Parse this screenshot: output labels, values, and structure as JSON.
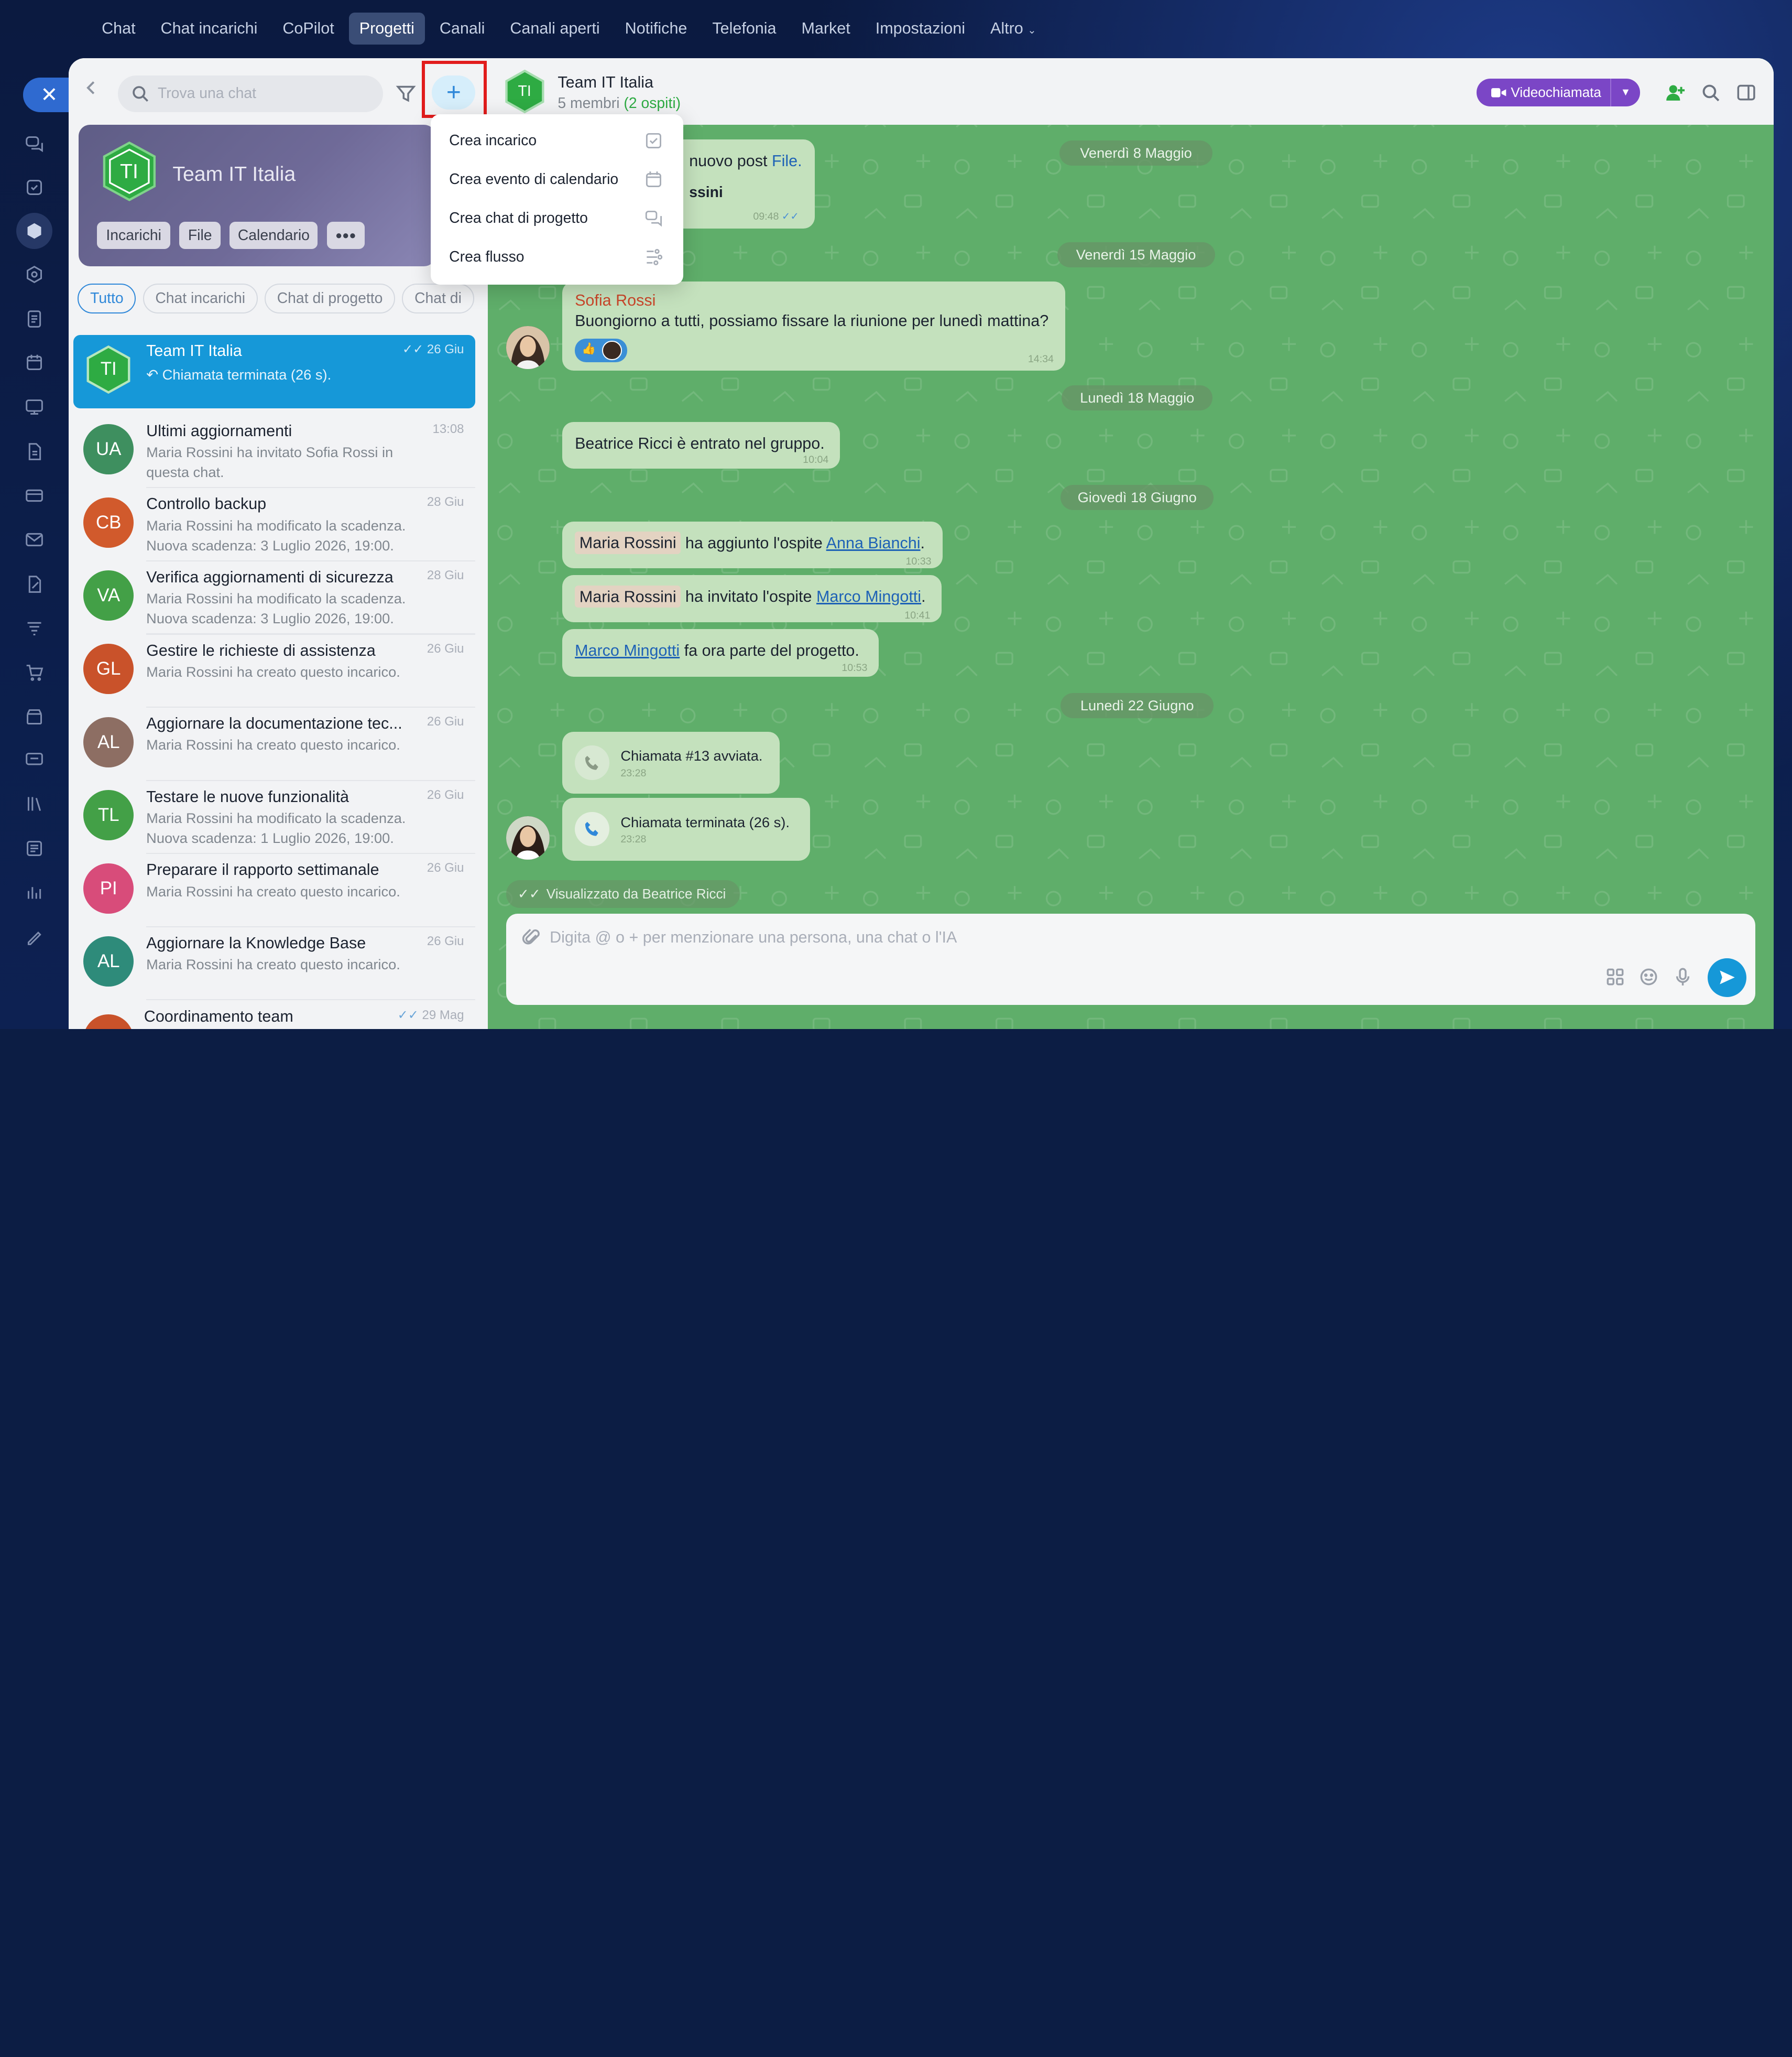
{
  "topnav": [
    "Chat",
    "Chat incarichi",
    "CoPilot",
    "Progetti",
    "Canali",
    "Canali aperti",
    "Notifiche",
    "Telefonia",
    "Market",
    "Impostazioni",
    "Altro"
  ],
  "topnav_active": "Progetti",
  "search": {
    "placeholder": "Trova una chat"
  },
  "project": {
    "initials": "TI",
    "name": "Team IT Italia",
    "buttons": [
      "Incarichi",
      "File",
      "Calendario"
    ]
  },
  "filters": [
    "Tutto",
    "Chat incarichi",
    "Chat di progetto",
    "Chat di"
  ],
  "menu": [
    "Crea incarico",
    "Crea evento di calendario",
    "Crea chat di progetto",
    "Crea flusso"
  ],
  "chats": [
    {
      "initials": "TI",
      "name": "Team IT Italia",
      "time": "26 Giu",
      "sub": "Chiamata terminata (26 s).",
      "color": "#2eab43"
    },
    {
      "initials": "UA",
      "name": "Ultimi aggiornamenti",
      "time": "13:08",
      "sub1": "Maria Rossini ha invitato Sofia Rossi in",
      "sub2": "questa chat.",
      "color": "#3e8f5f"
    },
    {
      "initials": "CB",
      "name": "Controllo backup",
      "time": "28 Giu",
      "sub1": "Maria Rossini ha modificato la scadenza.",
      "sub2": "Nuova scadenza: 3 Luglio 2026, 19:00.",
      "color": "#d15a2c"
    },
    {
      "initials": "VA",
      "name": "Verifica aggiornamenti di sicurezza",
      "time": "28 Giu",
      "sub1": "Maria Rossini ha modificato la scadenza.",
      "sub2": "Nuova scadenza: 3 Luglio 2026, 19:00.",
      "color": "#43a047"
    },
    {
      "initials": "GL",
      "name": "Gestire le richieste di assistenza",
      "time": "26 Giu",
      "sub1": "Maria Rossini ha creato questo incarico.",
      "color": "#c9522a"
    },
    {
      "initials": "AL",
      "name": "Aggiornare la documentazione tec...",
      "time": "26 Giu",
      "sub1": "Maria Rossini ha creato questo incarico.",
      "color": "#8d6e63"
    },
    {
      "initials": "TL",
      "name": "Testare le nuove funzionalità",
      "time": "26 Giu",
      "sub1": "Maria Rossini ha modificato la scadenza.",
      "sub2": "Nuova scadenza: 1 Luglio 2026, 19:00.",
      "color": "#43a047"
    },
    {
      "initials": "PI",
      "name": "Preparare il rapporto settimanale",
      "time": "26 Giu",
      "sub1": "Maria Rossini ha creato questo incarico.",
      "color": "#d84c7a"
    },
    {
      "initials": "AL",
      "name": "Aggiornare la Knowledge Base",
      "time": "26 Giu",
      "sub1": "Maria Rossini ha creato questo incarico.",
      "color": "#2e8b7a"
    },
    {
      "initials": "",
      "name": "Coordinamento team",
      "time": "29 Mag",
      "color": "#c9522a"
    }
  ],
  "header": {
    "title": "Team IT Italia",
    "members": "5 membri",
    "guests": "(2 ospiti)",
    "video_label": "Videochiamata"
  },
  "dates": {
    "d1": "Venerdì 8 Maggio",
    "d2": "Venerdì 15 Maggio",
    "d3": "Lunedì 18 Maggio",
    "d4": "Giovedì 18 Giugno",
    "d5": "Lunedì 22 Giugno"
  },
  "msg0": {
    "text": "nuovo post",
    "link": "File.",
    "author": "ssini",
    "time": "09:48"
  },
  "msg1": {
    "author": "Sofia Rossi",
    "text": "Buongiorno a tutti, possiamo fissare la riunione per lunedì mattina?",
    "time": "14:34"
  },
  "msg2": {
    "text": "Beatrice Ricci è entrato nel gruppo.",
    "time": "10:04"
  },
  "msg3": {
    "mention": "Maria Rossini",
    "text": "ha aggiunto l'ospite",
    "link": "Anna Bianchi",
    "time": "10:33"
  },
  "msg4": {
    "mention": "Maria Rossini",
    "text": "ha invitato l'ospite",
    "link": "Marco Mingotti",
    "time": "10:41"
  },
  "msg5": {
    "link": "Marco Mingotti",
    "text": "fa ora parte del progetto.",
    "time": "10:53"
  },
  "call1": {
    "text": "Chiamata #13 avviata.",
    "time": "23:28"
  },
  "call2": {
    "text": "Chiamata terminata (26 s).",
    "time": "23:28"
  },
  "seen": "Visualizzato da Beatrice Ricci",
  "composer": {
    "placeholder": "Digita @ o + per menzionare una persona, una chat o l'IA"
  },
  "colors": {
    "accent": "#1698d8",
    "video": "#7b46c6",
    "chat_bg": "#5fae6a",
    "highlight": "#e11c1c"
  }
}
